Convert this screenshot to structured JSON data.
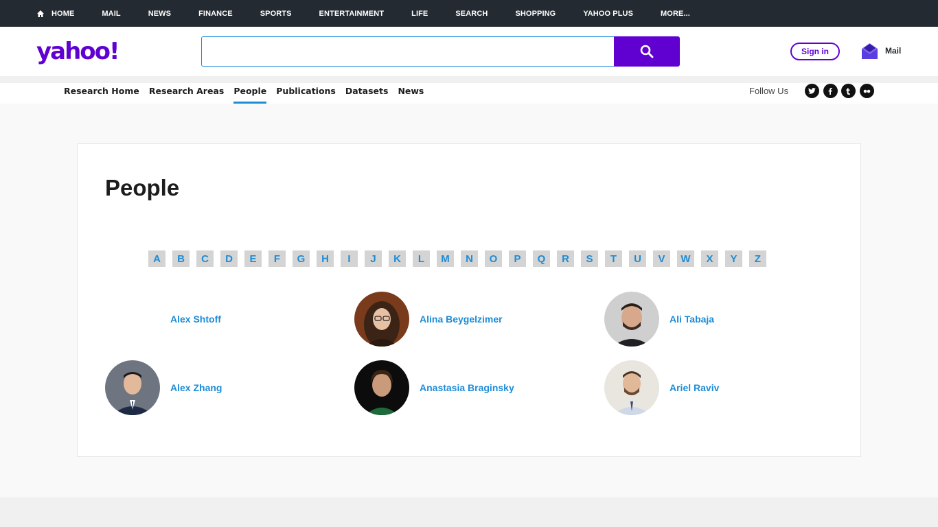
{
  "topnav": {
    "items": [
      "HOME",
      "MAIL",
      "NEWS",
      "FINANCE",
      "SPORTS",
      "ENTERTAINMENT",
      "LIFE",
      "SEARCH",
      "SHOPPING",
      "YAHOO PLUS",
      "MORE..."
    ]
  },
  "header": {
    "logo": "yahoo!",
    "search_value": "",
    "signin_label": "Sign in",
    "mail_label": "Mail"
  },
  "subnav": {
    "items": [
      "Research Home",
      "Research Areas",
      "People",
      "Publications",
      "Datasets",
      "News"
    ],
    "active": "People",
    "follow_label": "Follow Us",
    "social": [
      "twitter-icon",
      "facebook-icon",
      "tumblr-icon",
      "flickr-icon"
    ]
  },
  "main": {
    "title": "People",
    "letters": [
      "A",
      "B",
      "C",
      "D",
      "E",
      "F",
      "G",
      "H",
      "I",
      "J",
      "K",
      "L",
      "M",
      "N",
      "O",
      "P",
      "Q",
      "R",
      "S",
      "T",
      "U",
      "V",
      "W",
      "X",
      "Y",
      "Z"
    ],
    "people": [
      {
        "name": "Alex Shtoff",
        "has_photo": false
      },
      {
        "name": "Alina Beygelzimer",
        "has_photo": true
      },
      {
        "name": "Ali Tabaja",
        "has_photo": true
      },
      {
        "name": "Alex Zhang",
        "has_photo": true
      },
      {
        "name": "Anastasia Braginsky",
        "has_photo": true
      },
      {
        "name": "Ariel Raviv",
        "has_photo": true
      }
    ]
  },
  "colors": {
    "brand": "#6001d2",
    "link": "#1d8cd6",
    "topbar": "#232a31"
  }
}
